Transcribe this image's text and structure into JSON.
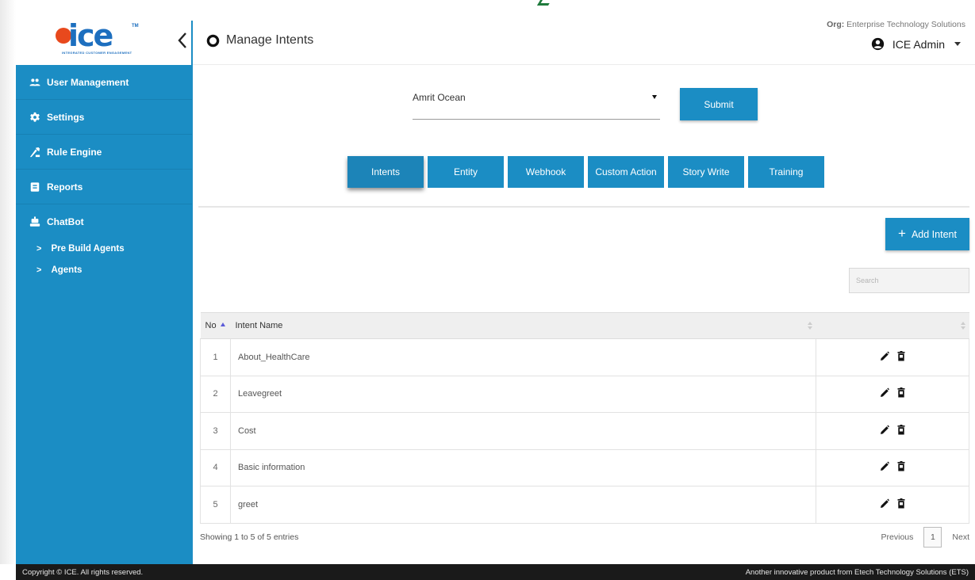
{
  "brand": {
    "logo_text": "ice",
    "logo_tagline": "INTEGRATED CUSTOMER ENGAGEMENT",
    "logo_tm": "TM"
  },
  "header": {
    "title": "Manage Intents",
    "org_label": "Org:",
    "org_name": "Enterprise Technology Solutions",
    "user_name": "ICE Admin"
  },
  "sidebar": {
    "items": [
      {
        "label": "User Management",
        "icon": "users-icon"
      },
      {
        "label": "Settings",
        "icon": "gear-icon"
      },
      {
        "label": "Rule Engine",
        "icon": "rule-engine-icon"
      },
      {
        "label": "Reports",
        "icon": "report-icon"
      },
      {
        "label": "ChatBot",
        "icon": "robot-icon"
      }
    ],
    "sub_items": [
      {
        "label": "Pre Build Agents"
      },
      {
        "label": "Agents"
      }
    ]
  },
  "agent_select": {
    "value": "Amrit Ocean"
  },
  "submit_label": "Submit",
  "tabs": [
    {
      "label": "Intents",
      "active": true
    },
    {
      "label": "Entity",
      "active": false
    },
    {
      "label": "Webhook",
      "active": false
    },
    {
      "label": "Custom Action",
      "active": false
    },
    {
      "label": "Story Write",
      "active": false
    },
    {
      "label": "Training",
      "active": false
    }
  ],
  "add_intent_label": "Add Intent",
  "search": {
    "placeholder": "Search"
  },
  "table": {
    "columns": [
      "No",
      "Intent Name",
      ""
    ],
    "rows": [
      {
        "no": "1",
        "name": "About_HealthCare"
      },
      {
        "no": "2",
        "name": "Leavegreet"
      },
      {
        "no": "3",
        "name": "Cost"
      },
      {
        "no": "4",
        "name": "Basic information"
      },
      {
        "no": "5",
        "name": "greet"
      }
    ]
  },
  "table_info": "Showing 1 to 5 of 5 entries",
  "pagination": {
    "previous": "Previous",
    "current_page": "1",
    "next": "Next"
  },
  "footer": {
    "left": "Copyright © ICE. All rights reserved.",
    "right": "Another innovative product from Etech Technology Solutions (ETS)"
  },
  "colors": {
    "primary": "#1b8dc4",
    "footer_bg": "#1a1a1a",
    "logo_blue": "#1d6fbf",
    "logo_orange": "#e8491d"
  }
}
